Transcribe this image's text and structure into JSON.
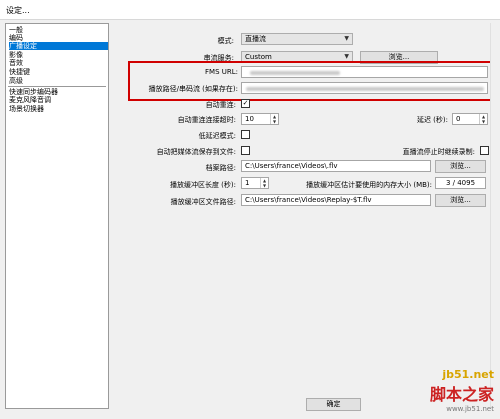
{
  "window": {
    "title": "设定..."
  },
  "sidebar": {
    "items": [
      {
        "label": "一般",
        "selected": false
      },
      {
        "label": "编码",
        "selected": false
      },
      {
        "label": "广播设定",
        "selected": true
      },
      {
        "label": "影像",
        "selected": false
      },
      {
        "label": "音效",
        "selected": false
      },
      {
        "label": "快捷键",
        "selected": false
      },
      {
        "label": "高级",
        "selected": false
      },
      {
        "label": "快速同步编码器",
        "selected": false
      },
      {
        "label": "麦克风降音调",
        "selected": false
      },
      {
        "label": "场景切换器",
        "selected": false
      }
    ]
  },
  "form": {
    "mode_label": "模式:",
    "mode_value": "直播流",
    "service_label": "串流服务:",
    "service_value": "Custom",
    "browse_label": "浏览...",
    "fms_url_label": "FMS URL:",
    "stream_path_label": "播放路径/串码流 (如果存在):",
    "auto_reconnect_label": "自动重连:",
    "auto_reconnect_checked": true,
    "reconnect_timeout_label": "自动重连连接超时:",
    "reconnect_timeout_value": "10",
    "delay_label": "延迟 (秒):",
    "delay_value": "0",
    "low_latency_label": "低延迟模式:",
    "save_to_file_label": "自动把媒体流保存到文件:",
    "keep_recording_label": "直播流停止时继续录制:",
    "file_path_label": "档案路径:",
    "file_path_value": "C:\\Users\\france\\Videos\\.flv",
    "browse2_label": "浏览...",
    "replay_buffer_label": "播放缓冲区长度 (秒):",
    "replay_buffer_value": "1",
    "memory_label": "播放缓冲区估计要使用的内存大小 (MB):",
    "memory_value": "3 / 4095",
    "replay_file_label": "播放缓冲区文件路径:",
    "replay_file_value": "C:\\Users\\france\\Videos\\Replay-$T.flv",
    "browse3_label": "浏览..."
  },
  "footer": {
    "ok_label": "确定"
  },
  "watermark": {
    "line1": "jb51.net",
    "line2": "脚本之家",
    "line3": "www.jb51.net"
  },
  "icons": {
    "arrow": "chevron-down-icon",
    "check": "checkmark-icon",
    "spinner": "spinner-arrows-icon"
  }
}
